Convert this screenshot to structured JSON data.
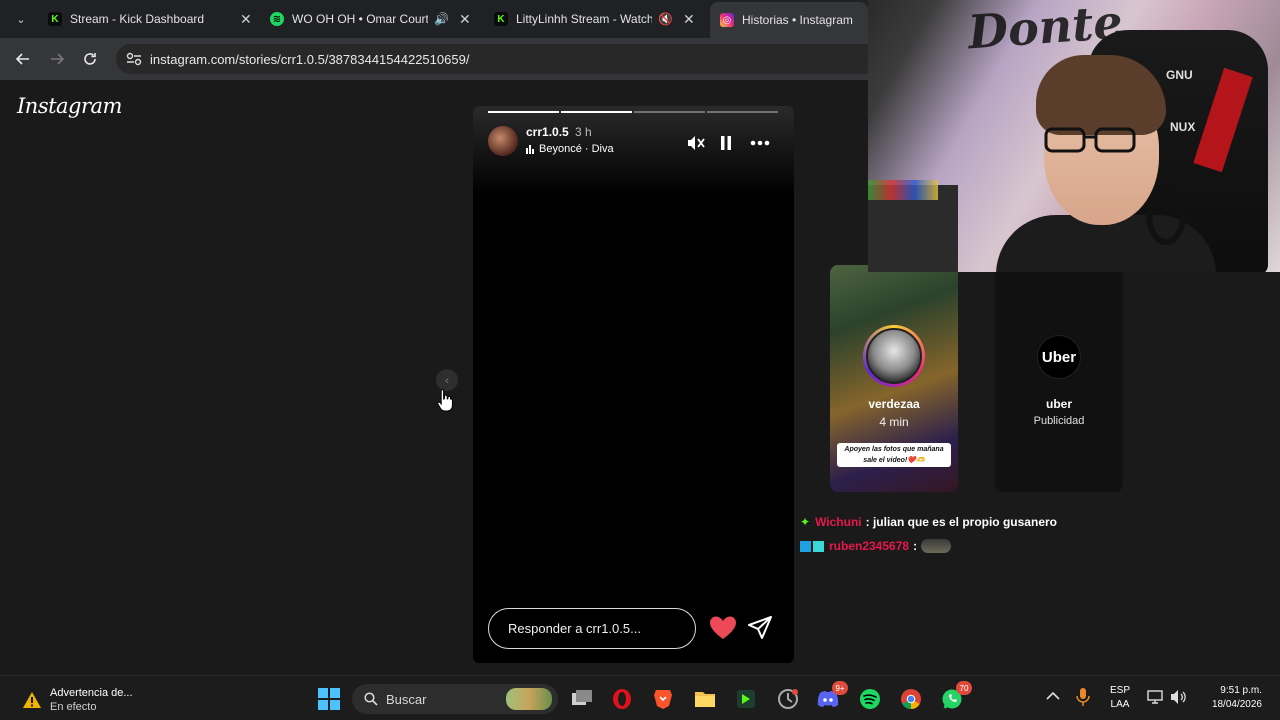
{
  "browser": {
    "tabs": [
      {
        "title": "Stream - Kick Dashboard",
        "icon": "kick-icon"
      },
      {
        "title": "WO OH OH • Omar Courtz,",
        "icon": "spotify-icon",
        "audio": "speaker-icon"
      },
      {
        "title": "LittyLinhh Stream - Watch L",
        "icon": "kick-icon",
        "audio": "muted-speaker-icon"
      },
      {
        "title": "Historias • Instagram",
        "icon": "instagram-icon",
        "active": true
      }
    ],
    "url": "instagram.com/stories/crr1.0.5/3878344154422510659/"
  },
  "instagram": {
    "logo": "Instagram",
    "story": {
      "username": "crr1.0.5",
      "time": "3 h",
      "music": "Beyoncé · Diva",
      "progress_segments": 4,
      "progress_completed": 2,
      "reply_placeholder": "Responder a crr1.0.5..."
    },
    "next_stories": [
      {
        "name": "verdezaa",
        "sub": "4 min",
        "caption": "Apoyen las fotos que mañana sale el video!❤️🫶"
      },
      {
        "name": "uber",
        "sub": "Publicidad",
        "logo": "Uber"
      }
    ]
  },
  "webcam": {
    "graffiti": "Donte",
    "chair_text_top": "GNU",
    "chair_text_bottom": "NUX"
  },
  "chat": [
    {
      "user": "Wichuni",
      "message": ": julian que es el propio gusanero"
    },
    {
      "user": "ruben2345678",
      "message": ":"
    }
  ],
  "taskbar": {
    "warning_title": "Advertencia de...",
    "warning_sub": "En efecto",
    "search_placeholder": "Buscar",
    "discord_badge": "9+",
    "whatsapp_badge": "70",
    "lang_top": "ESP",
    "lang_bottom": "LAA",
    "time": "9:51 p.m.",
    "date": "18/04/2026"
  },
  "colors": {
    "kick_green": "#53fc18",
    "spotify_green": "#1ed760",
    "heart_red": "#ed4956",
    "chat_user": "#e8174d"
  }
}
